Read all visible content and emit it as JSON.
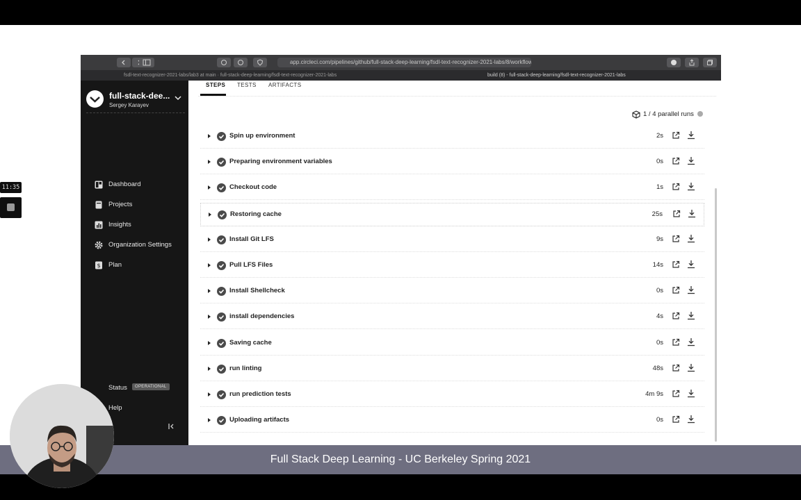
{
  "overlay": {
    "clock": "11:35",
    "caption": "Full Stack Deep Learning - UC Berkeley Spring 2021"
  },
  "sidebar": {
    "org_name": "full-stack-dee...",
    "org_user": "Sergey Karayev",
    "items": [
      {
        "label": "Dashboard",
        "icon": "dashboard-icon"
      },
      {
        "label": "Projects",
        "icon": "projects-icon"
      },
      {
        "label": "Insights",
        "icon": "insights-icon"
      },
      {
        "label": "Organization Settings",
        "icon": "gear-icon"
      },
      {
        "label": "Plan",
        "icon": "plan-icon"
      }
    ],
    "status_label": "Status",
    "status_badge": "OPERATIONAL",
    "help_label": "Help"
  },
  "main": {
    "tabs": [
      {
        "label": "STEPS",
        "active": true
      },
      {
        "label": "TESTS",
        "active": false
      },
      {
        "label": "ARTIFACTS",
        "active": false
      }
    ],
    "parallel_runs": "1 / 4 parallel runs",
    "steps": [
      {
        "name": "Spin up environment",
        "duration": "2s"
      },
      {
        "name": "Preparing environment variables",
        "duration": "0s"
      },
      {
        "name": "Checkout code",
        "duration": "1s"
      },
      {
        "name": "Restoring cache",
        "duration": "25s"
      },
      {
        "name": "Install Git LFS",
        "duration": "9s"
      },
      {
        "name": "Pull LFS Files",
        "duration": "14s"
      },
      {
        "name": "Install Shellcheck",
        "duration": "0s"
      },
      {
        "name": "install dependencies",
        "duration": "4s"
      },
      {
        "name": "Saving cache",
        "duration": "0s"
      },
      {
        "name": "run linting",
        "duration": "48s"
      },
      {
        "name": "run prediction tests",
        "duration": "4m 9s"
      },
      {
        "name": "Uploading artifacts",
        "duration": "0s"
      }
    ]
  },
  "colors": {
    "sidebar_bg": "#161616",
    "caption_bg": "#6e6e80",
    "check_bg": "#4a4a4a"
  }
}
